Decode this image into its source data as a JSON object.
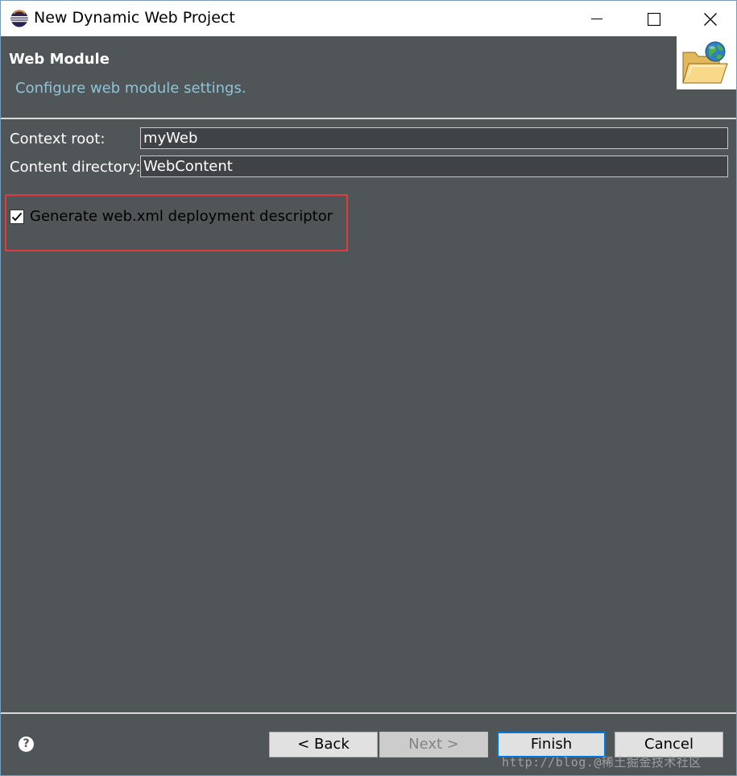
{
  "window": {
    "title": "New Dynamic Web Project",
    "controls": {
      "minimize": "minimize-icon",
      "maximize": "maximize-icon",
      "close": "close-icon"
    }
  },
  "header": {
    "title": "Web Module",
    "description": "Configure web module settings.",
    "image": "web-project-folder-globe-icon"
  },
  "form": {
    "context_root": {
      "label": "Context root:",
      "value": "myWeb"
    },
    "content_directory": {
      "label": "Content directory:",
      "value": "WebContent"
    },
    "generate_descriptor": {
      "label": "Generate web.xml deployment descriptor",
      "checked": true
    }
  },
  "footer": {
    "help_icon": "?",
    "back_label": "< Back",
    "next_label": "Next >",
    "finish_label": "Finish",
    "cancel_label": "Cancel"
  },
  "watermark": "http://blog.@稀土掘金技术社区",
  "colors": {
    "background": "#505558",
    "header_description": "#8fc4d8",
    "highlight_border": "#e23b3b",
    "default_button_border": "#0078d7"
  }
}
